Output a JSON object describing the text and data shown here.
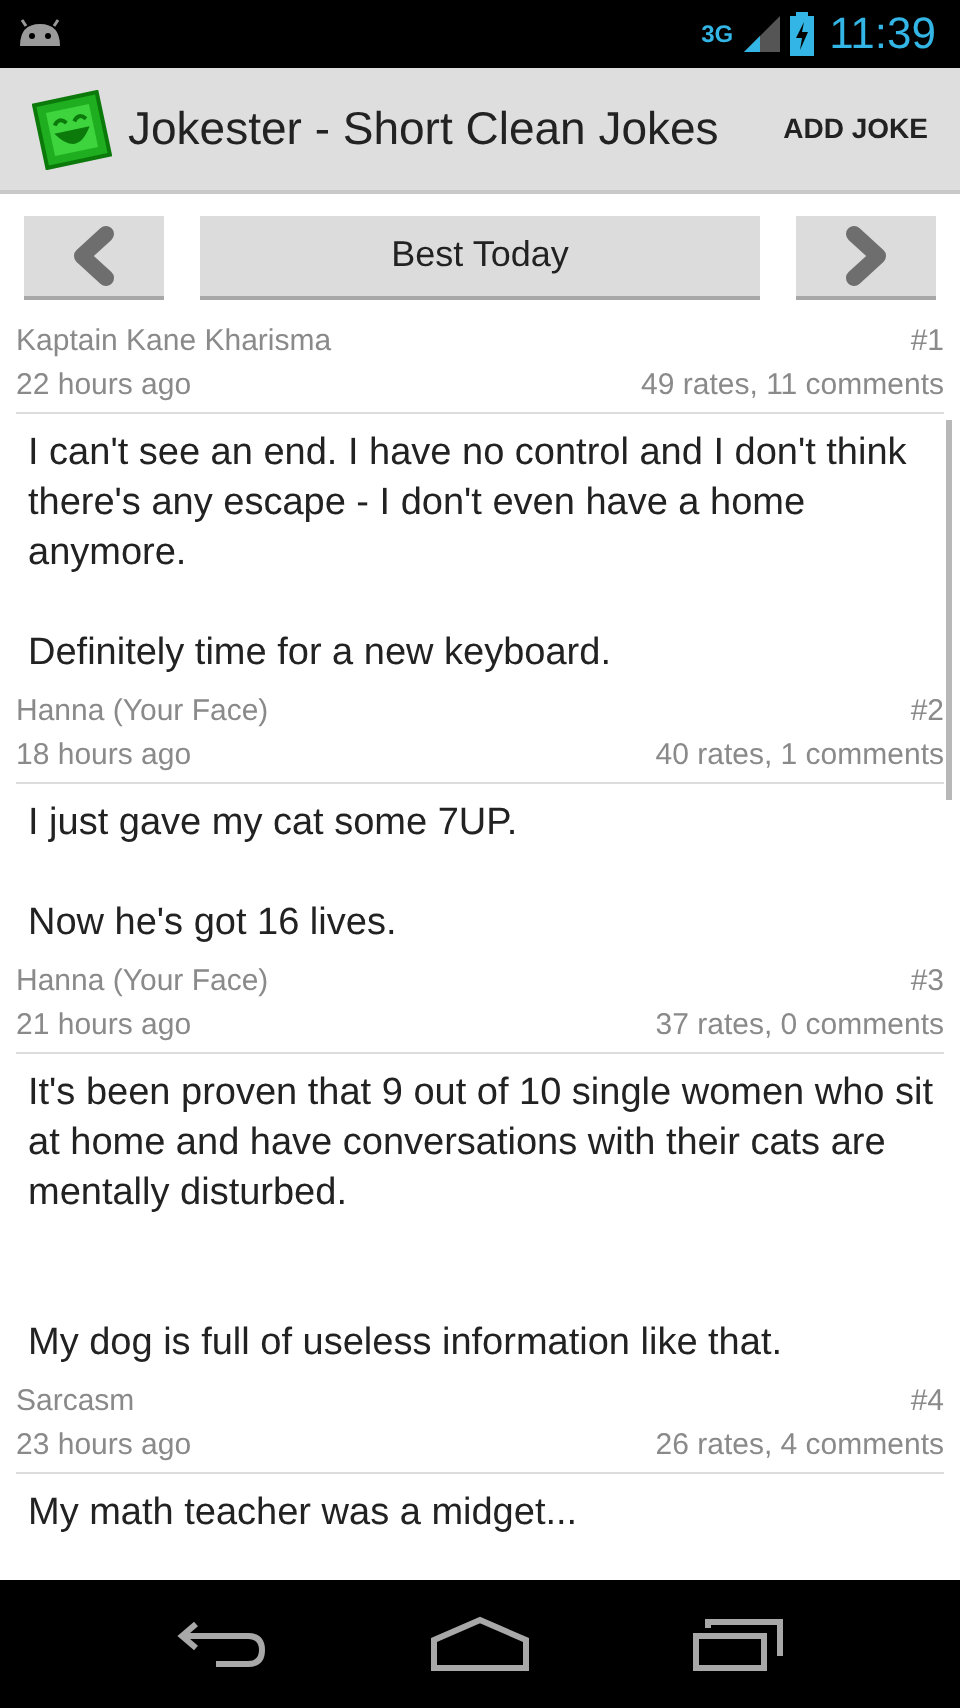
{
  "status_bar": {
    "network": "3G",
    "time": "11:39"
  },
  "action_bar": {
    "title": "Jokester - Short Clean Jokes",
    "action": "ADD JOKE"
  },
  "navigator": {
    "label": "Best Today"
  },
  "jokes": [
    {
      "author": "Kaptain Kane Kharisma",
      "rank": "#1",
      "time": "22 hours ago",
      "stats": "49 rates, 11 comments",
      "text": "I can't see an end. I have no control and I don't think there's any escape - I don't even have a home anymore.\n\nDefinitely time for a new keyboard."
    },
    {
      "author": "Hanna (Your Face)",
      "rank": "#2",
      "time": "18 hours ago",
      "stats": "40 rates, 1 comments",
      "text": "I just gave my cat some 7UP.\n\nNow he's got 16 lives."
    },
    {
      "author": "Hanna (Your Face)",
      "rank": "#3",
      "time": "21 hours ago",
      "stats": "37 rates, 0 comments",
      "text": "It's been proven that 9 out of 10 single women who sit at home and have conversations with their cats are mentally disturbed.\n\n\nMy dog is full of useless information like that."
    },
    {
      "author": "Sarcasm",
      "rank": "#4",
      "time": "23 hours ago",
      "stats": "26 rates, 4 comments",
      "text": "My math teacher was a midget..."
    }
  ]
}
